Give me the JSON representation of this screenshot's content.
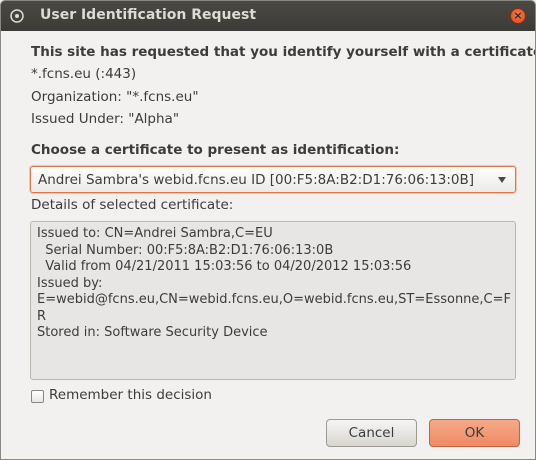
{
  "window": {
    "title": "User Identification Request"
  },
  "request": {
    "heading": "This site has requested that you identify yourself with a certificate:",
    "host": "*.fcns.eu (:443)",
    "organization": "Organization: \"*.fcns.eu\"",
    "issued_under": "Issued Under: \"Alpha\""
  },
  "chooser": {
    "heading": "Choose a certificate to present as identification:",
    "selected": "Andrei Sambra's webid.fcns.eu ID [00:F5:8A:B2:D1:76:06:13:0B]"
  },
  "details": {
    "label": "Details of selected certificate:",
    "lines": [
      "Issued to: CN=Andrei Sambra,C=EU",
      "  Serial Number: 00:F5:8A:B2:D1:76:06:13:0B",
      "  Valid from 04/21/2011 15:03:56 to 04/20/2012 15:03:56",
      "Issued by:",
      "E=webid@fcns.eu,CN=webid.fcns.eu,O=webid.fcns.eu,ST=Essonne,C=F",
      "R",
      "Stored in: Software Security Device"
    ]
  },
  "remember": {
    "label": "Remember this decision",
    "checked": false
  },
  "buttons": {
    "cancel": "Cancel",
    "ok": "OK"
  },
  "colors": {
    "accent": "#ef8a63",
    "titlebar": "#3c3b37"
  }
}
